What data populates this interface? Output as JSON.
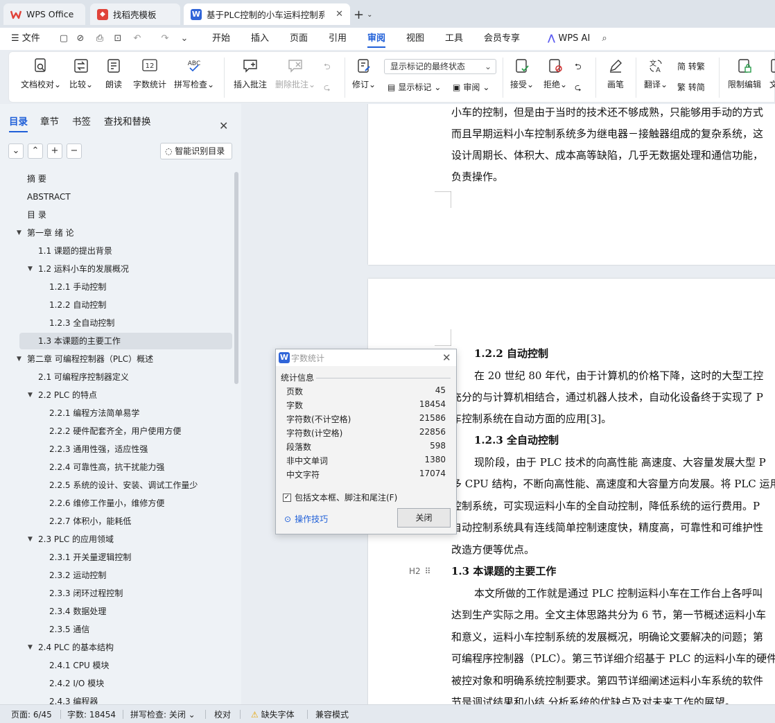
{
  "tabs": [
    {
      "label": "WPS Office"
    },
    {
      "label": "找稻壳模板"
    },
    {
      "label": "基于PLC控制的小车运料控制系"
    }
  ],
  "menu": {
    "file": "文件",
    "items": [
      "开始",
      "插入",
      "页面",
      "引用",
      "审阅",
      "视图",
      "工具",
      "会员专享"
    ],
    "active": "审阅",
    "wps_ai": "WPS AI"
  },
  "ribbon": {
    "doc_check": "文档校对",
    "compare": "比较",
    "read_aloud": "朗读",
    "word_count": "字数统计",
    "word_count_icon_text": "12",
    "spell_check": "拼写检查",
    "spell_icon_text": "ABC",
    "insert_comment": "插入批注",
    "delete_comment": "删除批注",
    "track_changes": "修订",
    "markup_select": "显示标记的最终状态",
    "show_markup": "显示标记",
    "review": "审阅",
    "accept": "接受",
    "reject": "拒绝",
    "pen": "画笔",
    "translate": "翻译",
    "to_traditional": "简 转繁",
    "to_simplified": "繁 转简",
    "restrict_edit": "限制编辑",
    "cut_label": "文"
  },
  "nav": {
    "tabs": [
      "目录",
      "章节",
      "书签",
      "查找和替换"
    ],
    "smart_toc": "智能识别目录",
    "toc": [
      {
        "label": "摘  要",
        "level": 0,
        "exp": ""
      },
      {
        "label": "ABSTRACT",
        "level": 0,
        "exp": ""
      },
      {
        "label": "目  录",
        "level": 0,
        "exp": ""
      },
      {
        "label": "第一章  绪  论",
        "level": 0,
        "exp": "open"
      },
      {
        "label": "1.1  课题的提出背景",
        "level": 1,
        "exp": ""
      },
      {
        "label": "1.2  运料小车的发展概况",
        "level": 1,
        "exp": "open"
      },
      {
        "label": "1.2.1 手动控制",
        "level": 2,
        "exp": ""
      },
      {
        "label": "1.2.2 自动控制",
        "level": 2,
        "exp": ""
      },
      {
        "label": "1.2.3 全自动控制",
        "level": 2,
        "exp": ""
      },
      {
        "label": "1.3  本课题的主要工作",
        "level": 1,
        "exp": "",
        "selected": true
      },
      {
        "label": "第二章  可编程控制器（PLC）概述",
        "level": 0,
        "exp": "open"
      },
      {
        "label": "2.1  可编程序控制器定义",
        "level": 1,
        "exp": ""
      },
      {
        "label": "2.2 PLC 的特点",
        "level": 1,
        "exp": "open"
      },
      {
        "label": "2.2.1 编程方法简单易学",
        "level": 2,
        "exp": ""
      },
      {
        "label": "2.2.2 硬件配套齐全，用户使用方便",
        "level": 2,
        "exp": ""
      },
      {
        "label": "2.2.3 通用性强，适应性强",
        "level": 2,
        "exp": ""
      },
      {
        "label": "2.2.4 可靠性高，抗干扰能力强",
        "level": 2,
        "exp": ""
      },
      {
        "label": "2.2.5 系统的设计、安装、调试工作量少",
        "level": 2,
        "exp": ""
      },
      {
        "label": "2.2.6 维修工作量小，维修方便",
        "level": 2,
        "exp": ""
      },
      {
        "label": "2.2.7 体积小，能耗低",
        "level": 2,
        "exp": ""
      },
      {
        "label": "2.3 PLC 的应用领域",
        "level": 1,
        "exp": "open"
      },
      {
        "label": "2.3.1 开关量逻辑控制",
        "level": 2,
        "exp": ""
      },
      {
        "label": "2.3.2 运动控制",
        "level": 2,
        "exp": ""
      },
      {
        "label": "2.3.3 闭环过程控制",
        "level": 2,
        "exp": ""
      },
      {
        "label": "2.3.4 数据处理",
        "level": 2,
        "exp": ""
      },
      {
        "label": "2.3.5 通信",
        "level": 2,
        "exp": ""
      },
      {
        "label": "2.4 PLC 的基本结构",
        "level": 1,
        "exp": "open"
      },
      {
        "label": "2.4.1 CPU 模块",
        "level": 2,
        "exp": ""
      },
      {
        "label": "2.4.2 I/O 模块",
        "level": 2,
        "exp": ""
      },
      {
        "label": "2.4.3 编程器",
        "level": 2,
        "exp": ""
      }
    ]
  },
  "document": {
    "page1_lines": [
      "小车的控制，但是由于当时的技术还不够成熟，只能够用手动的方式",
      "而且早期运料小车控制系统多为继电器－接触器组成的复杂系统，这",
      "设计周期长、体积大、成本高等缺陷，几乎无数据处理和通信功能，",
      "负责操作。"
    ],
    "page2_lines": [
      "1.2.2 自动控制",
      "在 20 世纪 80 年代，由于计算机的价格下降，这时的大型工控",
      "充分的与计算机相结合，通过机器人技术，自动化设备终于实现了 P",
      "车控制系统在自动方面的应用[3]。",
      "1.2.3 全自动控制",
      "现阶段，由于 PLC 技术的向高性能  高速度、大容量发展大型 P",
      "多 CPU 结构，不断向高性能、高速度和大容量方向发展。将 PLC 运用",
      "控制系统，可实现运料小车的全自动控制，降低系统的运行费用。P",
      "自动控制系统具有连线简单控制速度快，精度高，可靠性和可维护性",
      "改造方便等优点。",
      "1.3  本课题的主要工作",
      "本文所做的工作就是通过 PLC 控制运料小车在工作台上各呼叫",
      "达到生产实际之用。全文主体思路共分为 6 节，第一节概述运料小车",
      "和意义，运料小车控制系统的发展概况，明确论文要解决的问题；第",
      "可编程序控制器（PLC）。第三节详细介绍基于 PLC 的运料小车的硬件",
      "被控对象和明确系统控制要求。第四节详细阐述运料小车系统的软件",
      "节是调试结果和小结  分析系统的优缺点及对未来工作的展望。"
    ],
    "heading_tag": "H2"
  },
  "dialog": {
    "title": "字数统计",
    "group": "统计信息",
    "stats": [
      {
        "label": "页数",
        "value": "45"
      },
      {
        "label": "字数",
        "value": "18454"
      },
      {
        "label": "字符数(不计空格)",
        "value": "21586"
      },
      {
        "label": "字符数(计空格)",
        "value": "22856"
      },
      {
        "label": "段落数",
        "value": "598"
      },
      {
        "label": "非中文单词",
        "value": "1380"
      },
      {
        "label": "中文字符",
        "value": "17074"
      }
    ],
    "include_label": "包括文本框、脚注和尾注(F)",
    "include_checked": true,
    "tips": "操作技巧",
    "close": "关闭"
  },
  "status": {
    "page": "页面: 6/45",
    "words": "字数: 18454",
    "spell": "拼写检查: 关闭",
    "proof": "校对",
    "missing_font": "缺失字体",
    "compat": "兼容模式"
  },
  "colors": {
    "accent": "#1f5fd8",
    "wps_red": "#e0433a"
  }
}
